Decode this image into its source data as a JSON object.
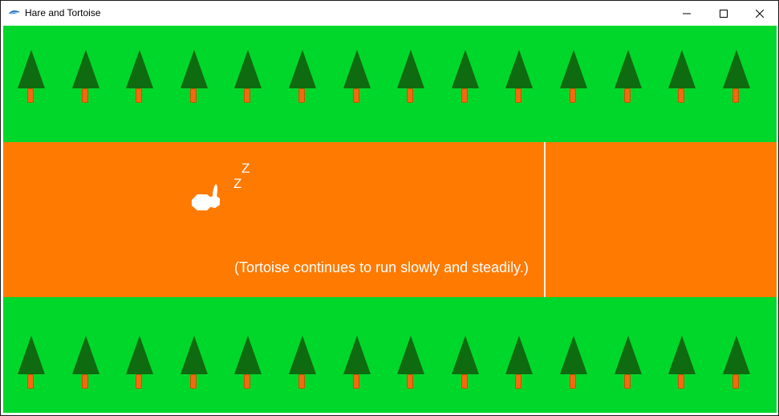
{
  "window": {
    "title": "Hare and Tortoise",
    "controls": [
      "minimize",
      "maximize",
      "close"
    ]
  },
  "scene": {
    "caption": "(Tortoise continues to run slowly and steadily.)",
    "sleep_text": [
      "Z",
      "Z"
    ],
    "trees_per_row": 14,
    "colors": {
      "grass": "#00d72b",
      "road": "#ff7a00",
      "tree_foliage": "#0f6b0f",
      "tree_trunk": "#f26a10",
      "hare": "#ffffff",
      "finish_line": "#fff3d9",
      "text": "#ffffff"
    }
  }
}
